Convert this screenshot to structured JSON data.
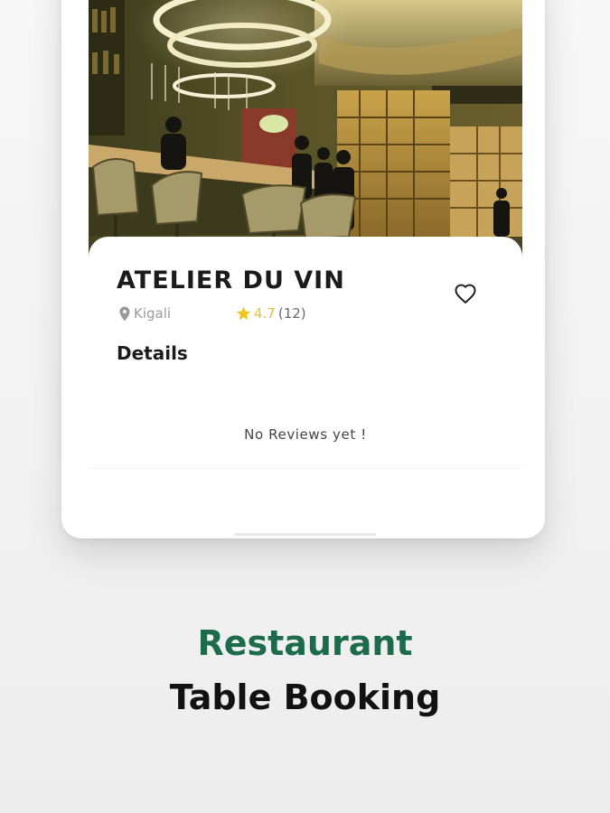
{
  "restaurant": {
    "name": "ATELIER DU VIN",
    "location": "Kigali",
    "rating": "4.7",
    "review_count": "(12)",
    "details_label": "Details",
    "no_reviews_text": "No Reviews yet !",
    "favorited": false
  },
  "promo": {
    "line1": "Restaurant",
    "line2": "Table Booking"
  },
  "colors": {
    "brand_green": "#1b6b4c",
    "star_yellow": "#f0c419",
    "rating_text": "#e3c23a",
    "muted_gray": "#9a9a9a"
  },
  "icons": {
    "favorite": "heart-outline-icon",
    "location": "map-pin-icon",
    "rating": "star-icon"
  }
}
